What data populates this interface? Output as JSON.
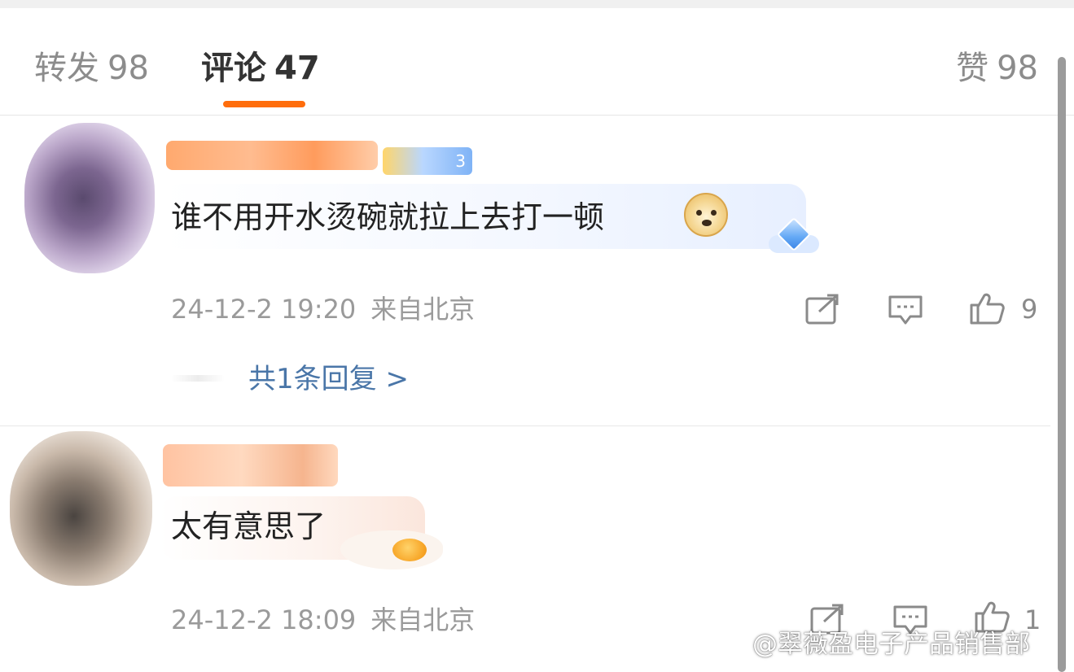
{
  "tabs": {
    "repost": {
      "label": "转发",
      "count": "98"
    },
    "comment": {
      "label": "评论",
      "count": "47"
    },
    "like": {
      "label": "赞",
      "count": "98"
    },
    "active_underline_color": "#ff6d0c"
  },
  "comments": [
    {
      "text": "谁不用开水烫碗就拉上去打一顿",
      "badge_level": "3",
      "emoji": "doge-icon",
      "decoration": "diamond-cloud-icon",
      "time": "24-12-2 19:20",
      "location": "来自北京",
      "likes": "9",
      "replies_link": "共1条回复 >"
    },
    {
      "text": "太有意思了",
      "decoration": "fried-egg-icon",
      "time": "24-12-2 18:09",
      "location": "来自北京",
      "likes": "1"
    }
  ],
  "watermark": "@翠薇盈电子产品销售部",
  "colors": {
    "link": "#4a76a8",
    "meta_text": "#9a9a9a",
    "accent": "#ff6d0c"
  }
}
